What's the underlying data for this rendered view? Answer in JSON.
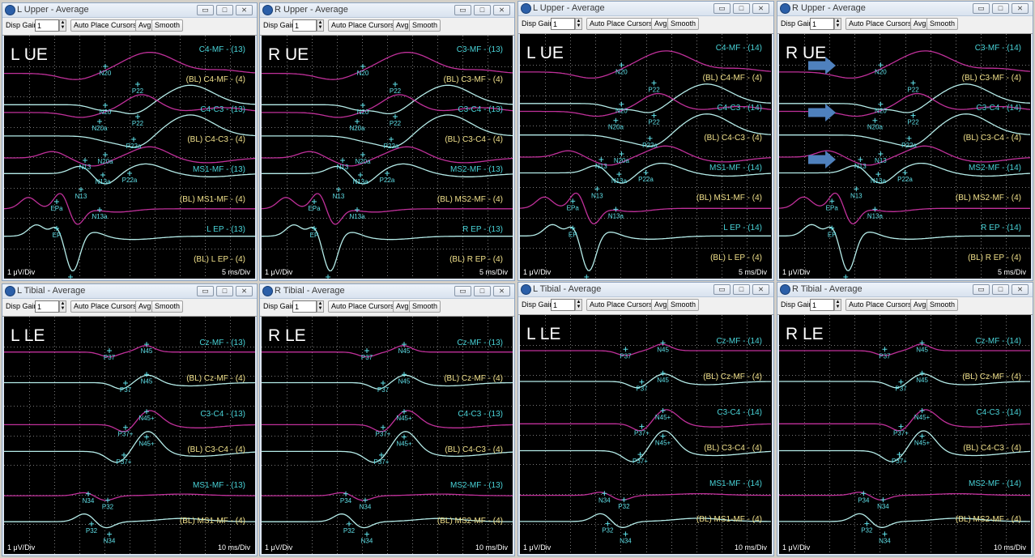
{
  "colors": {
    "trace_magenta": "#c0309a",
    "trace_cyan": "#b5ece9",
    "label_cyan": "#49d3d8",
    "label_yellow": "#f0e08a",
    "marker": "#5fe0e8",
    "arrow": "#4f81bd"
  },
  "toolbar": {
    "gain_label": "Disp Gain",
    "gain_value": "1",
    "auto_place_label": "Auto Place Cursors",
    "avg_label": "Avg",
    "smooth_label": "Smooth"
  },
  "window_buttons": {
    "minimize": "▭",
    "maximize": "□",
    "close": "⨯"
  },
  "panels": [
    {
      "title": "L Upper - Average",
      "label": "L UE",
      "scale_left": "1 μV/Div",
      "scale_right": "5 ms/Div",
      "channels": [
        "C4-MF - (13)",
        "(BL) C4-MF - (4)",
        "C4-C3 - (13)",
        "(BL) C4-C3 - (4)",
        "MS1-MF - (13)",
        "(BL) MS1-MF - (4)",
        "L EP - (13)",
        "(BL) L EP - (4)"
      ],
      "markers": [
        "N20",
        "P22",
        "N20",
        "P22",
        "N20a",
        "P22a",
        "N13",
        "N20a",
        "P22a",
        "N13",
        "N13a",
        "N13a",
        "EPa",
        "EP",
        "EPa"
      ]
    },
    {
      "title": "R Upper - Average",
      "label": "R UE",
      "scale_left": "1 μV/Div",
      "scale_right": "5 ms/Div",
      "channels": [
        "C3-MF - (13)",
        "(BL) C3-MF - (4)",
        "C3-C4 - (13)",
        "(BL) C3-C4 - (4)",
        "MS2-MF - (13)",
        "(BL) MS2-MF - (4)",
        "R EP - (13)",
        "(BL) R EP - (4)"
      ],
      "markers": [
        "N20",
        "P22",
        "N20",
        "P22",
        "N20a",
        "P22a",
        "N13",
        "N20a",
        "P22a",
        "N13",
        "N13a",
        "N13a",
        "EPa",
        "EP",
        "EPa"
      ]
    },
    {
      "title": "L Upper - Average",
      "label": "L UE",
      "scale_left": "1 μV/Div",
      "scale_right": "5 ms/Div",
      "channels": [
        "C4-MF - (14)",
        "(BL) C4-MF - (4)",
        "C4-C3 - (14)",
        "(BL) C4-C3 - (4)",
        "MS1-MF - (14)",
        "(BL) MS1-MF - (4)",
        "L EP - (14)",
        "(BL) L EP - (4)"
      ],
      "markers": [
        "N20",
        "P22",
        "N20",
        "P22",
        "N20a",
        "P22a",
        "N13",
        "N20a",
        "P22a",
        "N13",
        "N13a",
        "N13a",
        "EPa",
        "EP",
        "EPa"
      ]
    },
    {
      "title": "R Upper - Average",
      "label": "R UE",
      "scale_left": "1 μV/Div",
      "scale_right": "5 ms/Div",
      "channels": [
        "C3-MF - (14)",
        "(BL) C3-MF - (4)",
        "C3-C4 - (14)",
        "(BL) C3-C4 - (4)",
        "MS2-MF - (14)",
        "(BL) MS2-MF - (4)",
        "R EP - (14)",
        "(BL) R EP - (4)"
      ],
      "markers": [
        "N20",
        "P22",
        "N20",
        "P22",
        "N20a",
        "P22a",
        "N13",
        "N13",
        "P22a",
        "N13",
        "N13a",
        "N13a",
        "EPa",
        "EP",
        "EPa"
      ]
    },
    {
      "title": "L Tibial - Average",
      "label": "L LE",
      "scale_left": "1 μV/Div",
      "scale_right": "10 ms/Div",
      "channels": [
        "Cz-MF - (13)",
        "(BL) Cz-MF - (4)",
        "C3-C4 - (13)",
        "(BL) C3-C4 - (4)",
        "MS1-MF - (13)",
        "(BL) MS1-MF - (4)"
      ],
      "markers": [
        "P37",
        "N45",
        "P37",
        "N45",
        "P37+",
        "N45+",
        "P37+",
        "N45+",
        "N34",
        "P32",
        "P32",
        "N34"
      ]
    },
    {
      "title": "R Tibial - Average",
      "label": "R LE",
      "scale_left": "1 μV/Div",
      "scale_right": "10 ms/Div",
      "channels": [
        "Cz-MF - (13)",
        "(BL) Cz-MF - (4)",
        "C4-C3 - (13)",
        "(BL) C4-C3 - (4)",
        "MS2-MF - (13)",
        "(BL) MS2-MF - (4)"
      ],
      "markers": [
        "P37",
        "N45",
        "P37",
        "N45",
        "P37+",
        "N45+",
        "P37+",
        "N45+",
        "P34",
        "N34",
        "P32",
        "N34"
      ]
    },
    {
      "title": "L Tibial - Average",
      "label": "L LE",
      "scale_left": "1 μV/Div",
      "scale_right": "10 ms/Div",
      "channels": [
        "Cz-MF - (14)",
        "(BL) Cz-MF - (4)",
        "C3-C4 - (14)",
        "(BL) C3-C4 - (4)",
        "MS1-MF - (14)",
        "(BL) MS1-MF - (4)"
      ],
      "markers": [
        "P37",
        "N45",
        "P37",
        "N45",
        "P37+",
        "N45+",
        "P37+",
        "N45+",
        "N34",
        "P32",
        "P32",
        "N34"
      ]
    },
    {
      "title": "R Tibial - Average",
      "label": "R LE",
      "scale_left": "1 μV/Div",
      "scale_right": "10 ms/Div",
      "channels": [
        "Cz-MF - (14)",
        "(BL) Cz-MF - (4)",
        "C4-C3 - (14)",
        "(BL) C4-C3 - (4)",
        "MS2-MF - (14)",
        "(BL) MS2-MF - (4)"
      ],
      "markers": [
        "P37",
        "N45",
        "P37",
        "N45",
        "P37+",
        "N45+",
        "P37+",
        "N45+",
        "P34",
        "N34",
        "P32",
        "N34"
      ]
    }
  ]
}
